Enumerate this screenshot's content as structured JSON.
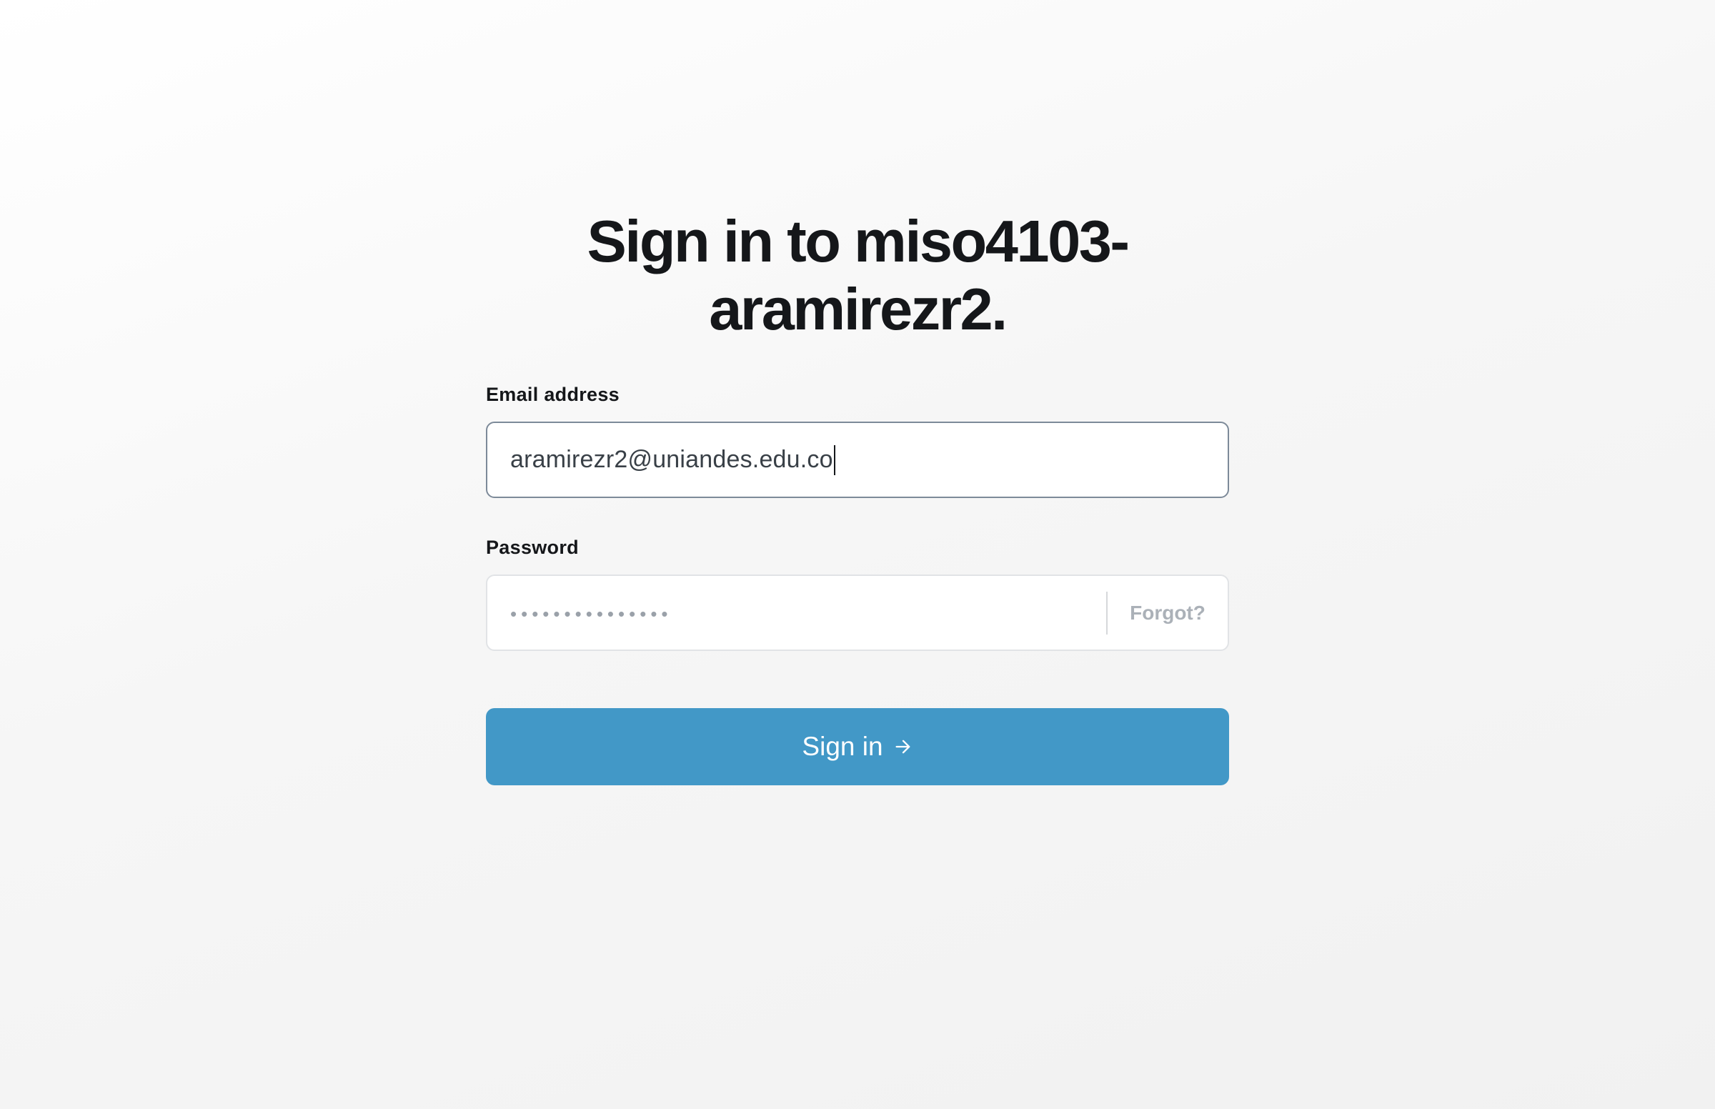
{
  "page": {
    "title": "Sign in to miso4103-aramirezr2."
  },
  "form": {
    "email_label": "Email address",
    "email_value": "aramirezr2@uniandes.edu.co",
    "password_label": "Password",
    "password_masked": "•••••••••••••••",
    "forgot_label": "Forgot?",
    "submit_label": "Sign in",
    "submit_icon": "arrow-right-icon"
  },
  "colors": {
    "accent": "#4298c7",
    "heading": "#15171a",
    "email_border_focused": "#7d8a99",
    "input_border": "#e1e3e6",
    "forgot_text": "#abb1b8"
  }
}
